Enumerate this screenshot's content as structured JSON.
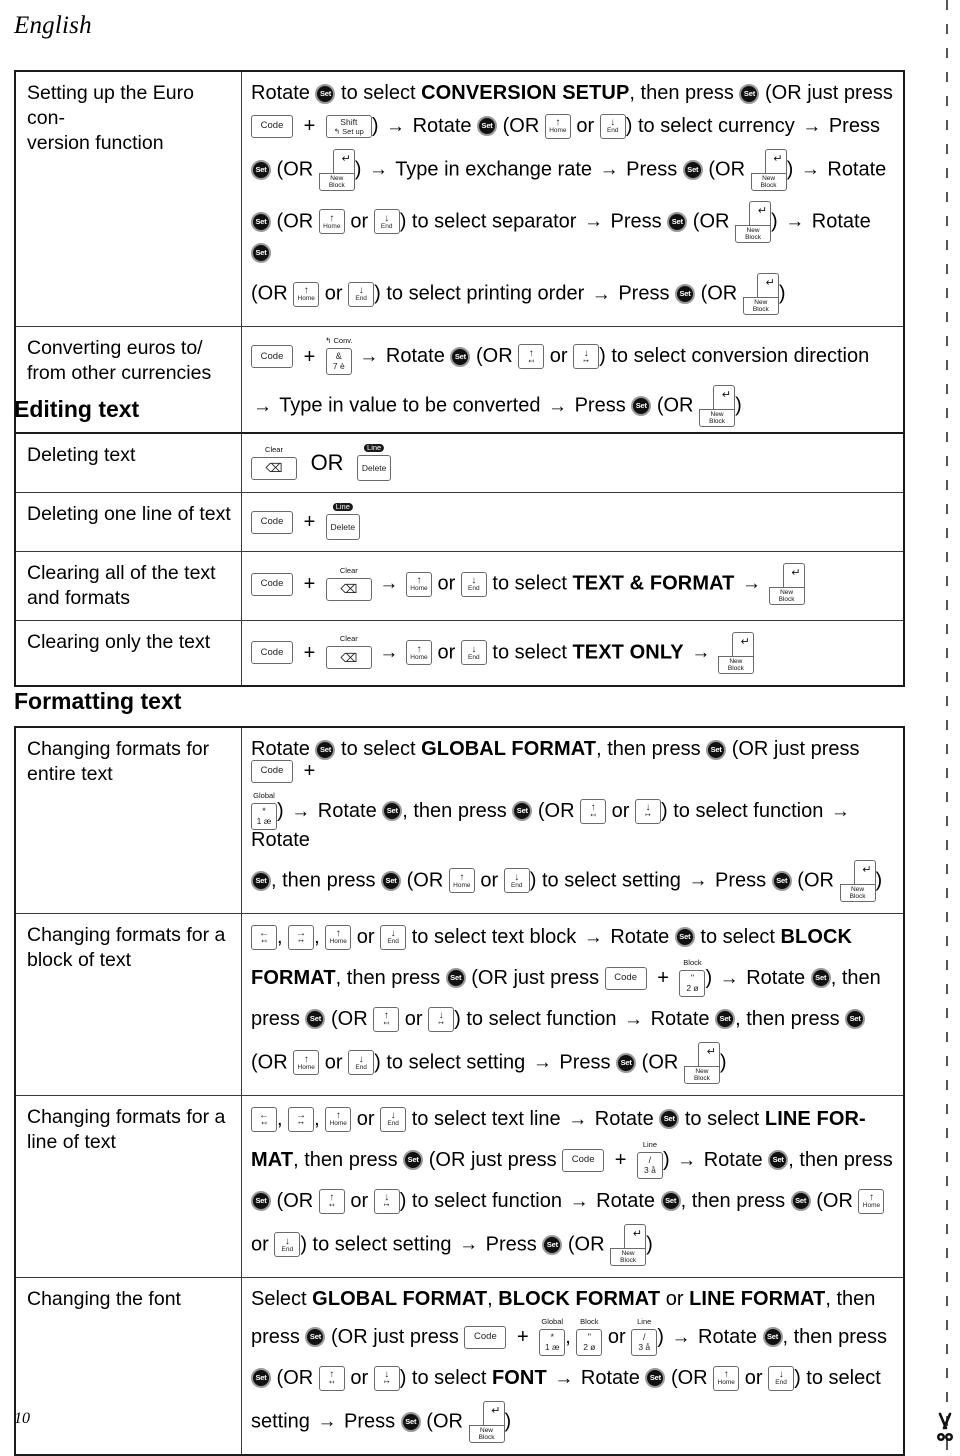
{
  "page": {
    "language_title": "English",
    "page_number": "10",
    "cut_line_icon": "scissors-icon"
  },
  "icons": {
    "set_dial": "Set",
    "right_arrow": "→",
    "or": "or",
    "or_big": "OR",
    "plus": "+",
    "comma": ","
  },
  "keys": {
    "code": {
      "label": "Code"
    },
    "shift_setup": {
      "l1": "Shift",
      "l2": "↰ Set up"
    },
    "home": {
      "arrow": "↑",
      "label": "Home"
    },
    "end": {
      "arrow": "↓",
      "label": "End"
    },
    "left": {
      "arrow": "←",
      "label": "↤"
    },
    "right": {
      "arrow": "→",
      "label": "↦"
    },
    "up_small": {
      "arrow": "↑",
      "label": "↤"
    },
    "down_small": {
      "arrow": "↓",
      "label": "↦"
    },
    "new_block": {
      "arrow": "↵",
      "label_1": "New",
      "label_2": "Block"
    },
    "clear_backspace": {
      "cap": "Clear",
      "glyph": "⌫"
    },
    "delete": {
      "cap": "Line",
      "label": "Delete"
    },
    "conv_7": {
      "cap": "↰ Conv.",
      "top": "&",
      "bot": "7  è"
    },
    "global_1": {
      "cap": "Global",
      "top": "*",
      "bot": "1  æ"
    },
    "block_2": {
      "cap": "Block",
      "top": "\"",
      "bot": "2  ø"
    },
    "line_3": {
      "cap": "Line",
      "top": "/",
      "bot": "3  å"
    }
  },
  "sections": [
    {
      "id": "euro",
      "heading": "",
      "rows": [
        {
          "label": "Setting up the Euro con-\nversion function",
          "lines": [
            "Rotate [SET] to select **CONVERSION SETUP**, then press [SET] (OR just press",
            "[CODE] + [SHIFT]) → Rotate [SET] (OR [HOME] or [END]) to select currency → Press",
            "[SET] (OR [NEWBLOCK]) → Type in exchange rate → Press [SET] (OR [NEWBLOCK]) → Rotate",
            "[SET] (OR [HOME] or [END]) to select separator → Press [SET] (OR [NEWBLOCK]) → Rotate [SET]",
            "(OR [HOME] or [END]) to select printing order → Press [SET] (OR [NEWBLOCK])"
          ]
        },
        {
          "label": "Converting euros to/\nfrom other currencies",
          "lines": [
            "[CODE] + [CONV7] → Rotate [SET] (OR [UPSM] or [DNSM]) to select conversion direction",
            "→ Type in value to be converted → Press [SET] (OR [NEWBLOCK])"
          ]
        }
      ]
    },
    {
      "id": "editing",
      "heading": "Editing text",
      "rows": [
        {
          "label": "Deleting text",
          "lines": [
            "[CLEAR] OR [DELETE]"
          ]
        },
        {
          "label": "Deleting one line of text",
          "lines": [
            "[CODE] + [DELETE]"
          ]
        },
        {
          "label": "Clearing all of the text\nand formats",
          "lines": [
            "[CODE] + [CLEAR] → [HOME] or [END] to select **TEXT & FORMAT** → [NEWBLOCK]"
          ]
        },
        {
          "label": "Clearing only the text",
          "lines": [
            "[CODE] + [CLEAR] → [HOME] or [END] to select **TEXT ONLY** → [NEWBLOCK]"
          ]
        }
      ]
    },
    {
      "id": "formatting",
      "heading": "Formatting text",
      "rows": [
        {
          "label": "Changing formats for\nentire text",
          "lines": [
            "Rotate [SET] to select **GLOBAL FORMAT**, then press [SET] (OR just press [CODE] +",
            "[GLOBAL1]) → Rotate [SET], then press [SET] (OR [UPSM] or [DNSM]) to select function → Rotate",
            "[SET], then press [SET] (OR [HOME] or [END]) to select setting → Press [SET] (OR [NEWBLOCK])"
          ]
        },
        {
          "label": "Changing formats for a\nblock of text",
          "lines": [
            "[LEFT], [RIGHT], [HOME] or [END] to select text block → Rotate [SET] to select **BLOCK**",
            "**FORMAT**, then press [SET] (OR just press [CODE] + [BLOCK2]) → Rotate [SET], then",
            "press [SET] (OR [UPSM] or [DNSM]) to select function → Rotate [SET], then press [SET]",
            "(OR [HOME] or [END]) to select setting → Press [SET] (OR [NEWBLOCK])"
          ]
        },
        {
          "label": "Changing formats for a\nline of text",
          "lines": [
            "[LEFT], [RIGHT], [HOME] or [END] to select text line → Rotate [SET] to select **LINE FOR-**",
            "**MAT**, then press [SET] (OR just press [CODE] + [LINE3]) → Rotate [SET], then press",
            "[SET] (OR [UPSM] or [DNSM]) to select function → Rotate [SET], then press [SET] (OR [HOME]",
            "or [END]) to select setting → Press [SET] (OR [NEWBLOCK])"
          ]
        },
        {
          "label": "Changing the font",
          "lines": [
            "Select **GLOBAL FORMAT**, **BLOCK FORMAT** or **LINE FORMAT**, then",
            "press [SET] (OR just press [CODE] + [GLOBAL1], [BLOCK2] or [LINE3]) → Rotate [SET], then press",
            "[SET] (OR [UPSM] or [DNSM]) to select **FONT** → Rotate [SET] (OR [HOME] or [END]) to select",
            "setting → Press [SET] (OR [NEWBLOCK])"
          ]
        }
      ]
    }
  ]
}
